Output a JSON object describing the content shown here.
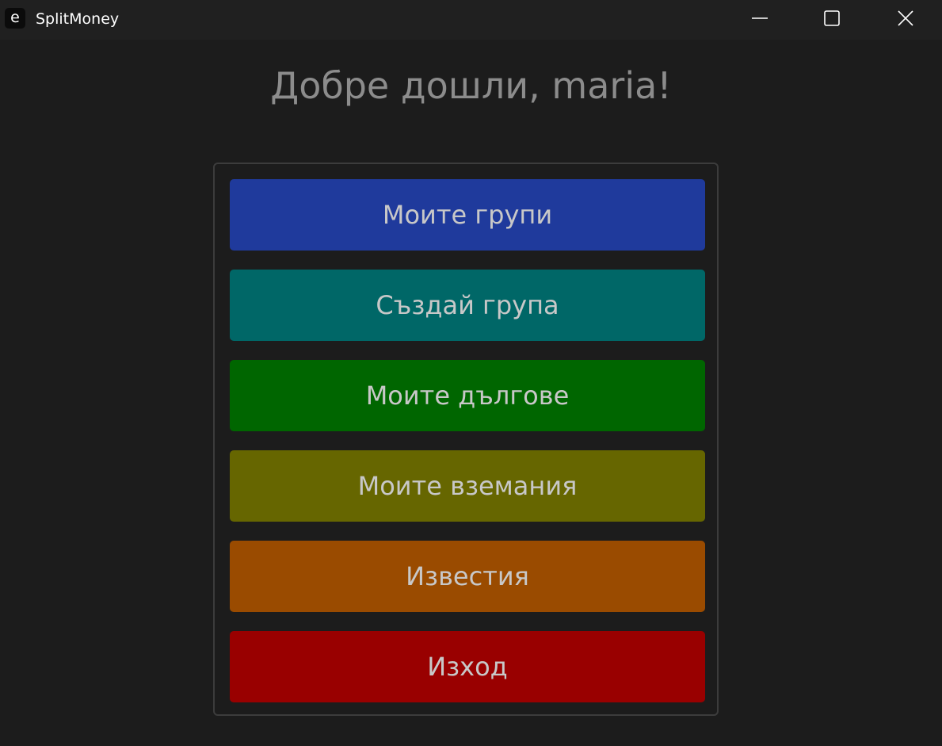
{
  "window": {
    "icon_glyph": "e",
    "title": "SplitMoney",
    "controls": [
      "minimize-icon",
      "maximize-icon",
      "close-icon"
    ]
  },
  "main": {
    "welcome": "Добре дошли, maria!"
  },
  "menu": {
    "buttons": [
      {
        "label": "Моите групи",
        "color": "#1f3a9c"
      },
      {
        "label": "Създай група",
        "color": "#006767"
      },
      {
        "label": "Моите дългове",
        "color": "#006600"
      },
      {
        "label": "Моите вземания",
        "color": "#666600"
      },
      {
        "label": "Известия",
        "color": "#9a4b00"
      },
      {
        "label": "Изход",
        "color": "#990000"
      }
    ]
  },
  "colors": {
    "background": "#1c1c1c",
    "titlebar": "#202020",
    "welcome_text": "#8c8c8c",
    "button_text": "#c8c8c8",
    "panel_border": "#3c3c3c"
  }
}
